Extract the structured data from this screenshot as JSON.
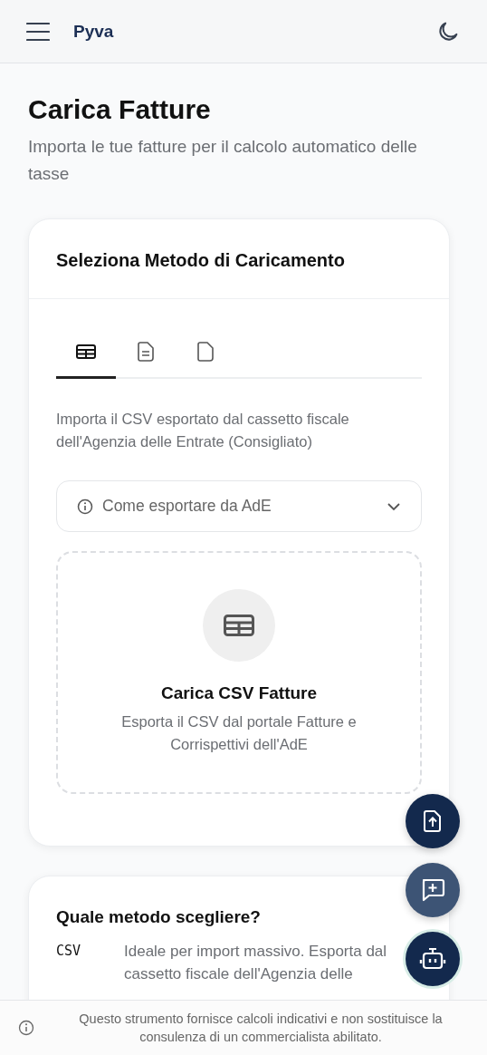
{
  "header": {
    "logo": "Pyva"
  },
  "page": {
    "title": "Carica Fatture",
    "subtitle": "Importa le tue fatture per il calcolo automatico delle tasse"
  },
  "upload_card": {
    "title": "Seleziona Metodo di Caricamento",
    "tabs": [
      {
        "kind": "table",
        "selected": true
      },
      {
        "kind": "document",
        "selected": false
      },
      {
        "kind": "file",
        "selected": false
      }
    ],
    "description": "Importa il CSV esportato dal cassetto fiscale dell'Agenzia delle Entrate (Consigliato)",
    "help_dropdown": {
      "label": "Come esportare da AdE",
      "expanded": false
    },
    "dropzone": {
      "title": "Carica CSV Fatture",
      "text": "Esporta il CSV dal portale Fatture e Corrispettivi dell'AdE"
    }
  },
  "method_card": {
    "title": "Quale metodo scegliere?",
    "rows": [
      {
        "method": "CSV",
        "text": "Ideale per import massivo. Esporta dal cassetto fiscale dell'Agenzia delle"
      }
    ]
  },
  "footer": {
    "disclaimer": "Questo strumento fornisce calcoli indicativi e non sostituisce la consulenza di un commercialista abilitato."
  }
}
